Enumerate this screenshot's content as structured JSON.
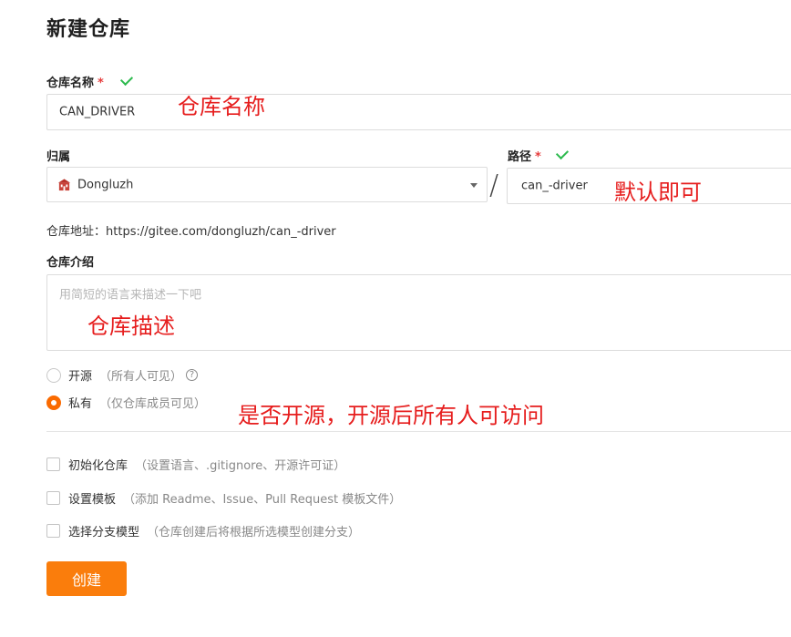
{
  "page_title": "新建仓库",
  "repo_name": {
    "label": "仓库名称",
    "required_mark": "*",
    "value": "CAN_DRIVER"
  },
  "owner": {
    "label": "归属",
    "value": "Dongluzh"
  },
  "path": {
    "label": "路径",
    "required_mark": "*",
    "value": "can_-driver"
  },
  "separator": "/",
  "address": {
    "label": "仓库地址：",
    "url": "https://gitee.com/dongluzh/can_-driver"
  },
  "description": {
    "label": "仓库介绍",
    "placeholder": "用简短的语言来描述一下吧"
  },
  "visibility": {
    "options": [
      {
        "label": "开源",
        "hint": "（所有人可见）",
        "selected": false,
        "help_icon": "?"
      },
      {
        "label": "私有",
        "hint": "（仅仓库成员可见）",
        "selected": true
      }
    ]
  },
  "options": [
    {
      "label": "初始化仓库",
      "hint": "（设置语言、.gitignore、开源许可证）",
      "checked": false
    },
    {
      "label": "设置模板",
      "hint": "（添加 Readme、Issue、Pull Request 模板文件）",
      "checked": false
    },
    {
      "label": "选择分支模型",
      "hint": "（仓库创建后将根据所选模型创建分支）",
      "checked": false
    }
  ],
  "create_button": "创建",
  "annotations": {
    "repo_name": "仓库名称",
    "path": "默认即可",
    "description": "仓库描述",
    "visibility": "是否开源，开源后所有人可访问"
  },
  "colors": {
    "accent": "#fa7d0c",
    "annotation": "#e61d1d",
    "check": "#2dba4e",
    "required": "#e63c3c"
  },
  "icons": {
    "valid": "check-icon",
    "owner": "building-icon",
    "dropdown": "caret-down-icon",
    "help": "question-circle-icon"
  }
}
